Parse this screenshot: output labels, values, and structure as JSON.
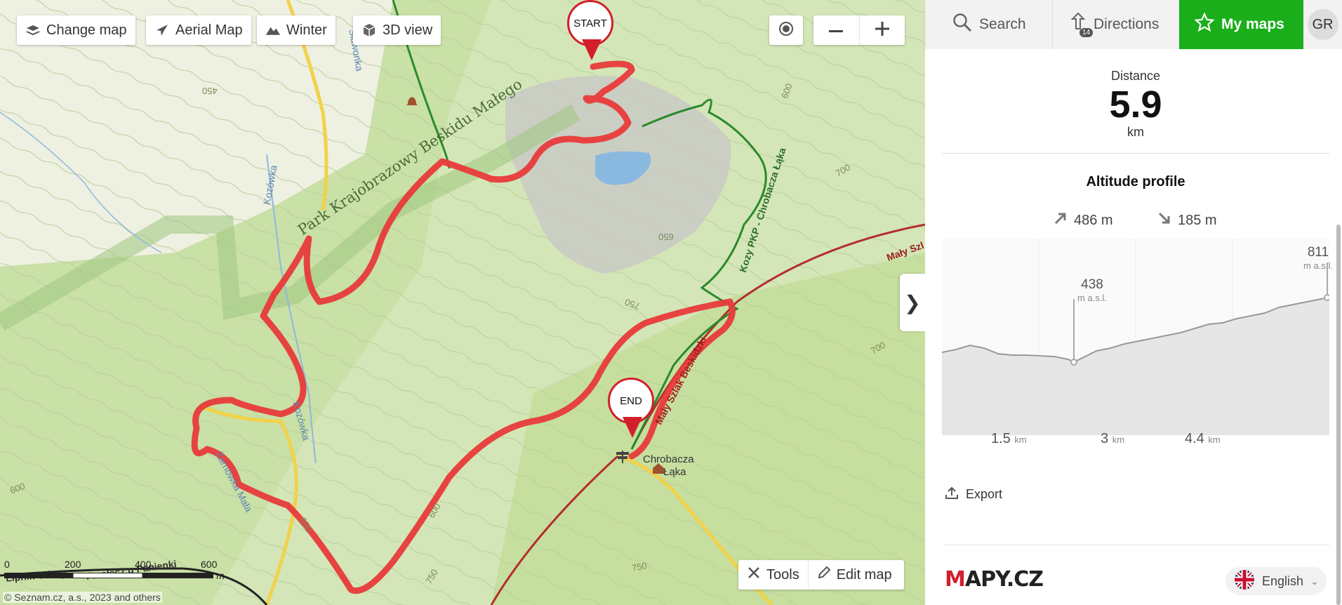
{
  "map": {
    "buttons": {
      "change_map": "Change map",
      "aerial_map": "Aerial Map",
      "winter": "Winter",
      "view_3d": "3D view"
    },
    "pins": {
      "start": "START",
      "end": "END"
    },
    "tools": {
      "tools": "Tools",
      "edit_map": "Edit map"
    },
    "labels": {
      "park": "Park Krajobrazowy Beskidu Małego",
      "trail1": "Mały Szlak Beskidzki",
      "trail2": "Mały Szl",
      "trail3": "Kozy PKP - Chrobacza Łąka",
      "stream1": "Kozówka",
      "stream2": "Kozówka",
      "stream3": "Żarnówka Mała",
      "stream4": "Sławonka",
      "place1": "Chrobacza",
      "place2": "Łąka",
      "c450": "450",
      "c600a": "600",
      "c600b": "600",
      "c650a": "650",
      "c650b": "650",
      "c700a": "700",
      "c700b": "700",
      "c750a": "750",
      "c750b": "750",
      "c750c": "750",
      "c600c": "600",
      "bottom_place": "Lipnik Górny",
      "bottom_place2": "Przełęcz u Panienki"
    },
    "scale": {
      "t0": "0",
      "t200": "200",
      "t400": "400",
      "t600": "600",
      "unit": "m"
    },
    "copyright": "© Seznam.cz, a.s., 2023 and others",
    "route_color": "#e83a3a"
  },
  "nav": {
    "search": "Search",
    "directions": "Directions",
    "directions_badge": "14",
    "my_maps": "My maps",
    "user_initials": "GR",
    "accent": "#1aae1a"
  },
  "panel": {
    "distance_label": "Distance",
    "distance_value": "5.9",
    "distance_unit": "km",
    "altitude_title": "Altitude profile",
    "ascent": "486 m",
    "descent": "185 m",
    "profile": {
      "peak_low_value": "438",
      "peak_low_unit": "m a.s.l.",
      "peak_high_value": "811",
      "peak_high_unit": "m a.s.l.",
      "km_ticks": [
        {
          "value": "1.5",
          "unit": "km"
        },
        {
          "value": "3",
          "unit": "km"
        },
        {
          "value": "4.4",
          "unit": "km"
        }
      ]
    },
    "export": "Export",
    "logo_m": "M",
    "logo_rest": "APY.CZ",
    "language": "English"
  }
}
